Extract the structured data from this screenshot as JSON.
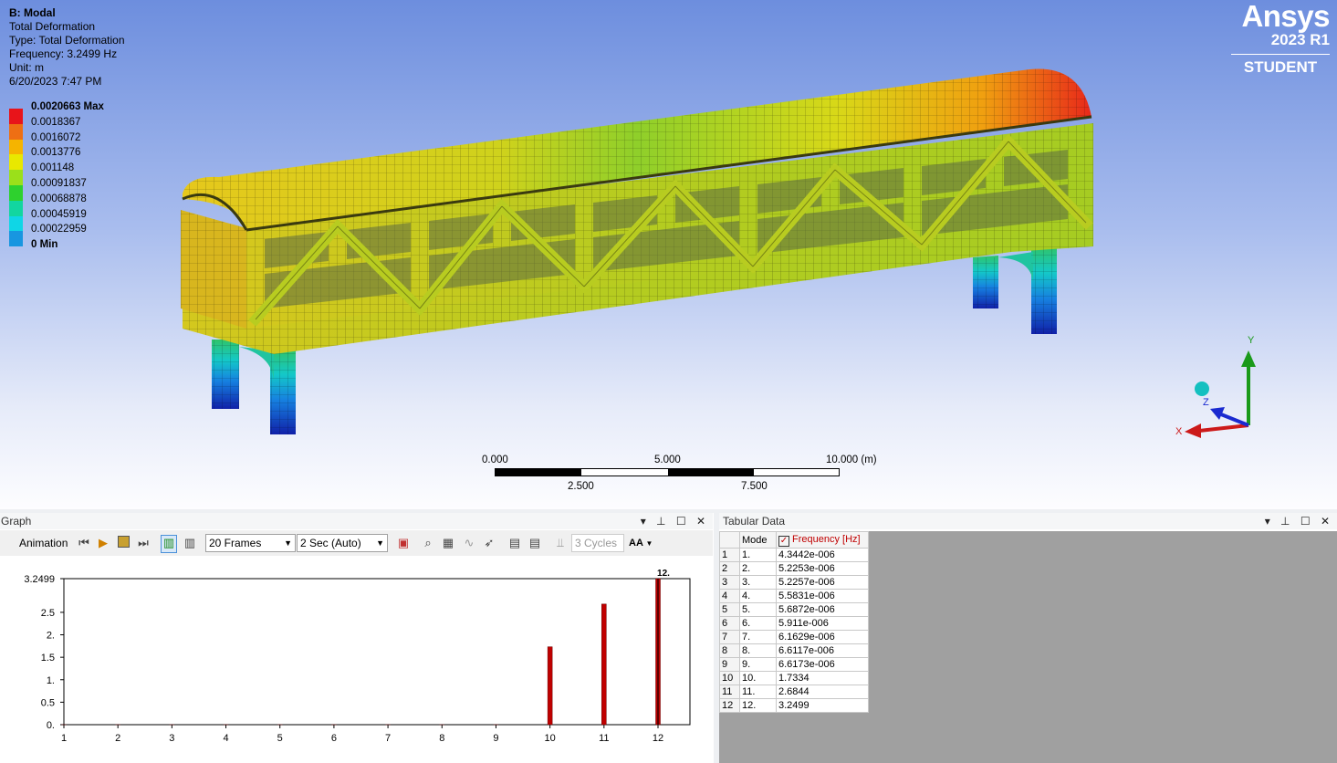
{
  "info": {
    "title": "B: Modal",
    "lines": [
      "Total Deformation",
      "Type: Total Deformation",
      "Frequency: 3.2499 Hz",
      "Unit: m",
      "6/20/2023 7:47 PM"
    ]
  },
  "legend": [
    {
      "label": "0.0020663 Max",
      "color": "#e8141a",
      "bold": true
    },
    {
      "label": "0.0018367",
      "color": "#ee6f14",
      "bold": false
    },
    {
      "label": "0.0016072",
      "color": "#f5b400",
      "bold": false
    },
    {
      "label": "0.0013776",
      "color": "#e9e800",
      "bold": false
    },
    {
      "label": "0.001148",
      "color": "#9be01a",
      "bold": false
    },
    {
      "label": "0.00091837",
      "color": "#2ed12e",
      "bold": false
    },
    {
      "label": "0.00068878",
      "color": "#12d6a0",
      "bold": false
    },
    {
      "label": "0.00045919",
      "color": "#0fd6e6",
      "bold": false
    },
    {
      "label": "0.00022959",
      "color": "#1896e0",
      "bold": false
    },
    {
      "label": "0 Min",
      "color": "#1030c8",
      "bold": true
    }
  ],
  "logo": {
    "brand": "Ansys",
    "version": "2023 R1",
    "edition": "STUDENT"
  },
  "triad": {
    "x": "X",
    "y": "Y",
    "z": "Z"
  },
  "scalebar": {
    "top": [
      "0.000",
      "5.000",
      "10.000 (m)"
    ],
    "bottom": [
      "2.500",
      "7.500"
    ]
  },
  "graph_pane": {
    "title": "Graph",
    "controls": "▾ ⊥ ☐ ✕",
    "animation_label": "Animation",
    "frames_value": "20 Frames",
    "duration_value": "2 Sec (Auto)",
    "cycles_value": "3 Cycles",
    "aa_label": "AA"
  },
  "tabular_pane": {
    "title": "Tabular Data",
    "controls": "▾ ⊥ ☐ ✕",
    "col_mode": "Mode",
    "col_freq": "Frequency [Hz]",
    "rows": [
      {
        "n": "1",
        "mode": "1.",
        "freq": "4.3442e-006"
      },
      {
        "n": "2",
        "mode": "2.",
        "freq": "5.2253e-006"
      },
      {
        "n": "3",
        "mode": "3.",
        "freq": "5.2257e-006"
      },
      {
        "n": "4",
        "mode": "4.",
        "freq": "5.5831e-006"
      },
      {
        "n": "5",
        "mode": "5.",
        "freq": "5.6872e-006"
      },
      {
        "n": "6",
        "mode": "6.",
        "freq": "5.911e-006"
      },
      {
        "n": "7",
        "mode": "7.",
        "freq": "6.1629e-006"
      },
      {
        "n": "8",
        "mode": "8.",
        "freq": "6.6117e-006"
      },
      {
        "n": "9",
        "mode": "9.",
        "freq": "6.6173e-006"
      },
      {
        "n": "10",
        "mode": "10.",
        "freq": "1.7334"
      },
      {
        "n": "11",
        "mode": "11.",
        "freq": "2.6844"
      },
      {
        "n": "12",
        "mode": "12.",
        "freq": "3.2499"
      }
    ]
  },
  "chart_data": {
    "type": "bar",
    "categories": [
      "1",
      "2",
      "3",
      "4",
      "5",
      "6",
      "7",
      "8",
      "9",
      "10",
      "11",
      "12"
    ],
    "values": [
      4.3442e-06,
      5.2253e-06,
      5.2257e-06,
      5.5831e-06,
      5.6872e-06,
      5.911e-06,
      6.1629e-06,
      6.6117e-06,
      6.6173e-06,
      1.7334,
      2.6844,
      3.2499
    ],
    "ytick_labels": [
      "0.",
      "0.5",
      "1.",
      "1.5",
      "2.",
      "2.5",
      "3.2499"
    ],
    "ytick_values": [
      0,
      0.5,
      1,
      1.5,
      2,
      2.5,
      3.2499
    ],
    "ylim": [
      0,
      3.2499
    ],
    "selected_label": "12.",
    "bar_color": "#c00000"
  }
}
